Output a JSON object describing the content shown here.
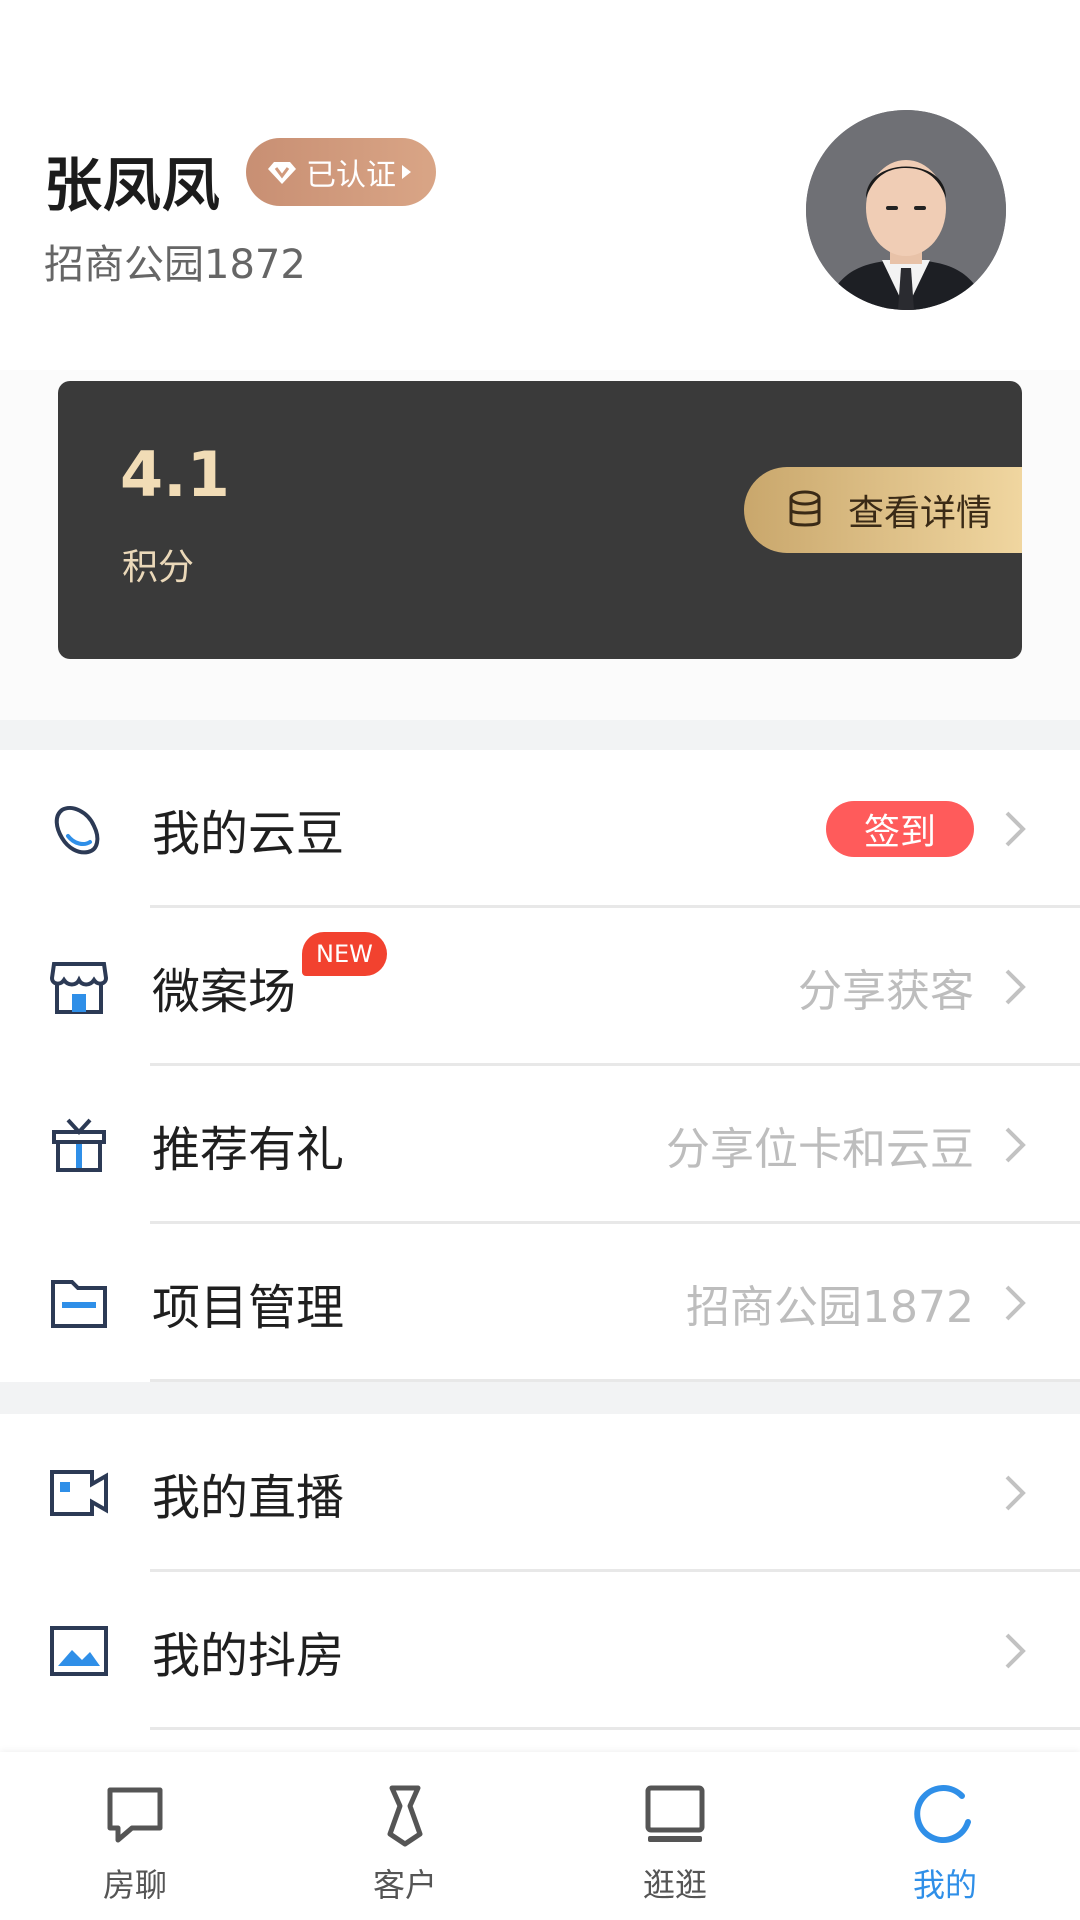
{
  "profile": {
    "name": "张凤凤",
    "verified_label": "已认证",
    "project": "招商公园1872"
  },
  "points": {
    "value": "4.1",
    "label": "积分",
    "details_button": "查看详情"
  },
  "menu": {
    "yundou": {
      "label": "我的云豆",
      "badge": "签到",
      "icon": "bean-icon"
    },
    "micro_site": {
      "label": "微案场",
      "new_badge": "NEW",
      "right_text": "分享获客",
      "icon": "storefront-icon"
    },
    "referral": {
      "label": "推荐有礼",
      "right_text": "分享位卡和云豆",
      "icon": "gift-icon"
    },
    "project_mgmt": {
      "label": "项目管理",
      "right_text": "招商公园1872",
      "icon": "folder-icon"
    },
    "live": {
      "label": "我的直播",
      "icon": "video-camera-icon"
    },
    "douyin_house": {
      "label": "我的抖房",
      "icon": "image-icon"
    }
  },
  "bottom_nav": {
    "items": [
      {
        "label": "房聊",
        "icon": "chat-icon"
      },
      {
        "label": "客户",
        "icon": "tie-icon"
      },
      {
        "label": "逛逛",
        "icon": "laptop-icon"
      },
      {
        "label": "我的",
        "icon": "profile-circle-icon"
      }
    ],
    "active_index": 3
  },
  "colors": {
    "accent_blue": "#2f8fe8",
    "card_dark": "#3a3a3a",
    "gold": "#e6c48c",
    "signin_red": "#ff5b5b",
    "new_red": "#f2422f"
  }
}
